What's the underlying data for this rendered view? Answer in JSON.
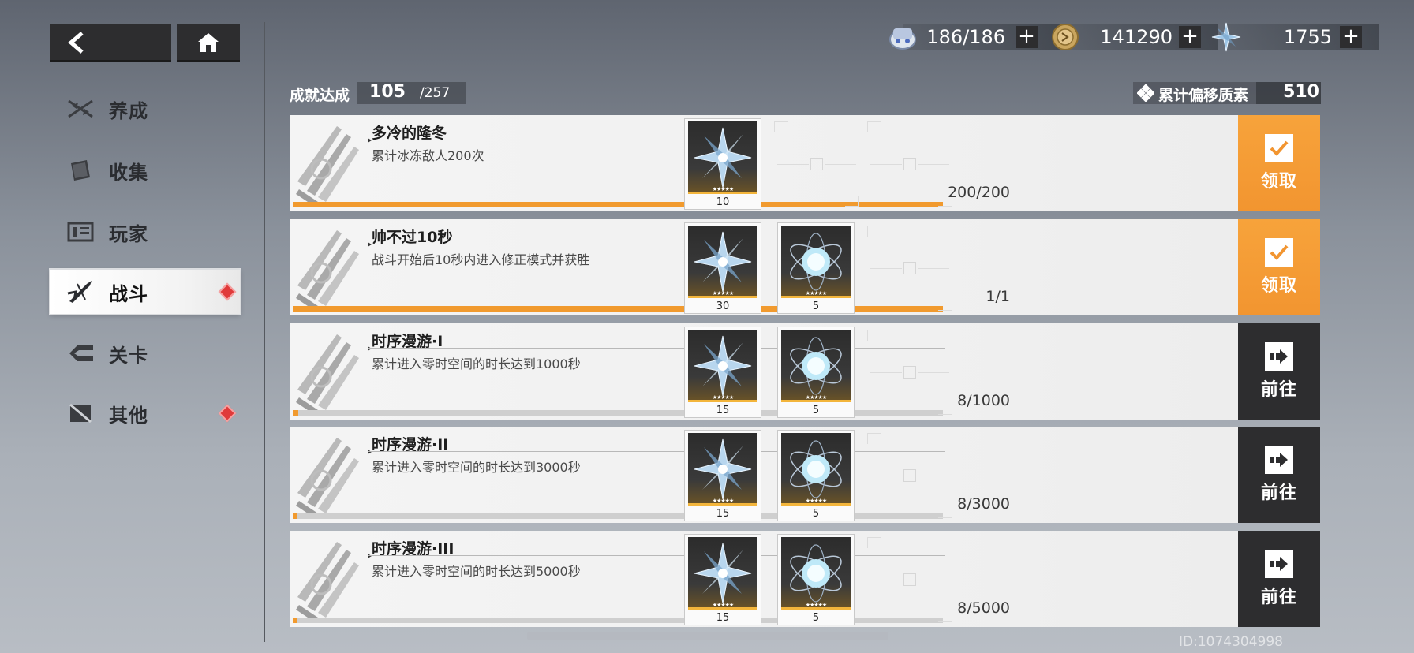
{
  "colors": {
    "accent": "#f29530",
    "dark": "#2d2d2f",
    "badge": "#e03a3a"
  },
  "nav": {
    "back_icon": "back-arrow-icon",
    "home_icon": "home-icon"
  },
  "sidebar": {
    "items": [
      {
        "label": "养成",
        "icon": "cultivate-icon",
        "active": false,
        "badge": false
      },
      {
        "label": "收集",
        "icon": "collection-icon",
        "active": false,
        "badge": false
      },
      {
        "label": "玩家",
        "icon": "player-icon",
        "active": false,
        "badge": false
      },
      {
        "label": "战斗",
        "icon": "battle-icon",
        "active": true,
        "badge": true
      },
      {
        "label": "关卡",
        "icon": "stage-icon",
        "active": false,
        "badge": false
      },
      {
        "label": "其他",
        "icon": "other-icon",
        "active": false,
        "badge": true
      }
    ]
  },
  "resources": {
    "stamina": "186/186",
    "coins": "141290",
    "crystals": "1755"
  },
  "summary": {
    "achieved_label": "成就达成",
    "achieved": "105",
    "total": "/257",
    "offset_label": "累计偏移质素",
    "offset_value": "510"
  },
  "tasks": [
    {
      "title": "多冷的隆冬",
      "desc": "累计冰冻敌人200次",
      "progress": "200/200",
      "progress_fraction": 1.0,
      "rewards": [
        {
          "type": "crystal",
          "qty": "10"
        }
      ],
      "action": "领取",
      "action_type": "claim"
    },
    {
      "title": "帅不过10秒",
      "desc": "战斗开始后10秒内进入修正模式并获胜",
      "progress": "1/1",
      "progress_fraction": 1.0,
      "rewards": [
        {
          "type": "crystal",
          "qty": "30"
        },
        {
          "type": "orb",
          "qty": "5"
        }
      ],
      "action": "领取",
      "action_type": "claim"
    },
    {
      "title": "时序漫游·I",
      "desc": "累计进入零时空间的时长达到1000秒",
      "progress": "8/1000",
      "progress_fraction": 0.008,
      "rewards": [
        {
          "type": "crystal",
          "qty": "15"
        },
        {
          "type": "orb",
          "qty": "5"
        }
      ],
      "action": "前往",
      "action_type": "go"
    },
    {
      "title": "时序漫游·II",
      "desc": "累计进入零时空间的时长达到3000秒",
      "progress": "8/3000",
      "progress_fraction": 0.0027,
      "rewards": [
        {
          "type": "crystal",
          "qty": "15"
        },
        {
          "type": "orb",
          "qty": "5"
        }
      ],
      "action": "前往",
      "action_type": "go"
    },
    {
      "title": "时序漫游·III",
      "desc": "累计进入零时空间的时长达到5000秒",
      "progress": "8/5000",
      "progress_fraction": 0.0016,
      "rewards": [
        {
          "type": "crystal",
          "qty": "15"
        },
        {
          "type": "orb",
          "qty": "5"
        }
      ],
      "action": "前往",
      "action_type": "go"
    }
  ],
  "uid": "ID:1074304998"
}
